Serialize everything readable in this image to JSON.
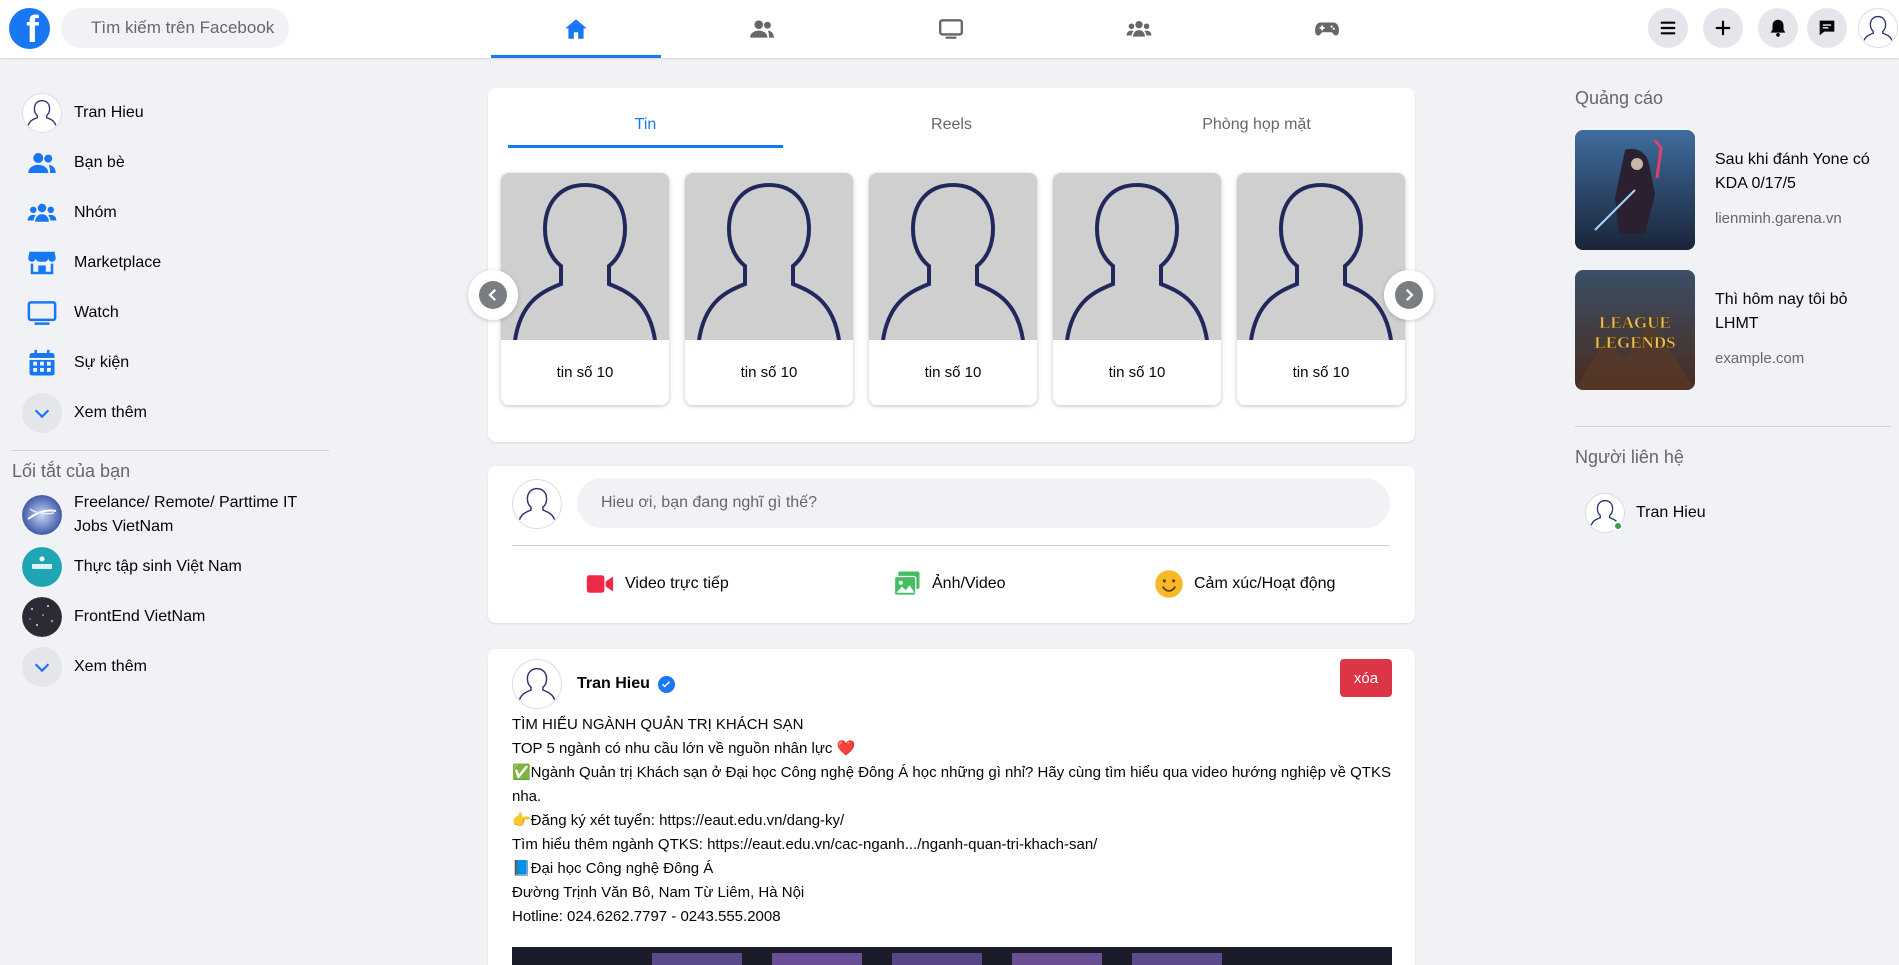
{
  "header": {
    "logo_letter": "f",
    "search_placeholder": "Tìm kiếm trên Facebook",
    "nav_icons": [
      "home-icon",
      "friends-icon",
      "watch-icon",
      "groups-icon",
      "gaming-icon"
    ],
    "right_icons": [
      "menu-icon",
      "plus-icon",
      "bell-icon",
      "messenger-icon",
      "profile-avatar"
    ],
    "accent": "#1877f2"
  },
  "sidebar": {
    "items": [
      {
        "label": "Tran Hieu",
        "icon": "avatar"
      },
      {
        "label": "Bạn bè",
        "icon": "friends-icon"
      },
      {
        "label": "Nhóm",
        "icon": "groups-icon"
      },
      {
        "label": "Marketplace",
        "icon": "store-icon"
      },
      {
        "label": "Watch",
        "icon": "tv-icon"
      },
      {
        "label": "Sự kiện",
        "icon": "calendar-icon"
      },
      {
        "label": "Xem thêm",
        "icon": "chevron-down-icon"
      }
    ],
    "shortcuts_title": "Lối tắt của bạn",
    "shortcuts": [
      {
        "label": "Freelance/ Remote/ Parttime IT Jobs VietNam"
      },
      {
        "label": "Thực tập sinh Việt Nam"
      },
      {
        "label": "FrontEnd VietNam"
      },
      {
        "label": "Xem thêm"
      }
    ]
  },
  "stories": {
    "tabs": [
      {
        "label": "Tin"
      },
      {
        "label": "Reels"
      },
      {
        "label": "Phòng họp mặt"
      }
    ],
    "cards": [
      {
        "label": "tin số 10"
      },
      {
        "label": "tin số 10"
      },
      {
        "label": "tin số 10"
      },
      {
        "label": "tin số 10"
      },
      {
        "label": "tin số 10"
      }
    ]
  },
  "composer": {
    "placeholder": "Hieu ơi, bạn đang nghĩ gì thế?",
    "actions": [
      {
        "label": "Video trực tiếp",
        "icon": "live-video-icon",
        "color": "#f02849"
      },
      {
        "label": "Ảnh/Video",
        "icon": "photo-icon",
        "color": "#45bd62"
      },
      {
        "label": "Cảm xúc/Hoạt động",
        "icon": "feeling-icon",
        "color": "#f7b928"
      }
    ]
  },
  "post": {
    "author": "Tran Hieu",
    "delete_label": "xóa",
    "lines": [
      "TÌM HIỂU NGÀNH QUẢN TRỊ KHÁCH SẠN",
      "TOP 5 ngành có nhu cầu lớn về nguồn nhân lực ❤️",
      "✅Ngành Quản trị Khách sạn ở Đại học Công nghệ Đông Á học những gì nhỉ? Hãy cùng tìm hiểu qua video hướng nghiệp về QTKS nha.",
      "👉Đăng ký xét tuyển: https://eaut.edu.vn/dang-ky/",
      "Tìm hiểu thêm ngành QTKS: https://eaut.edu.vn/cac-nganh.../nganh-quan-tri-khach-san/",
      "📘Đại học Công nghệ Đông Á",
      "Đường Trịnh Văn Bô, Nam Từ Liêm, Hà Nội",
      "Hotline: 024.6262.7797 - 0243.555.2008"
    ]
  },
  "right": {
    "ads_title": "Quảng cáo",
    "ads": [
      {
        "title": "Sau khi đánh Yone có KDA 0/17/5",
        "url": "lienminh.garena.vn"
      },
      {
        "title": "Thì hôm nay tôi bỏ LHMT",
        "url": "example.com",
        "logo_text": "LEAGUE OF LEGENDS"
      }
    ],
    "contacts_title": "Người liên hệ",
    "contacts": [
      {
        "name": "Tran Hieu",
        "status_color": "#31a24c"
      }
    ]
  }
}
